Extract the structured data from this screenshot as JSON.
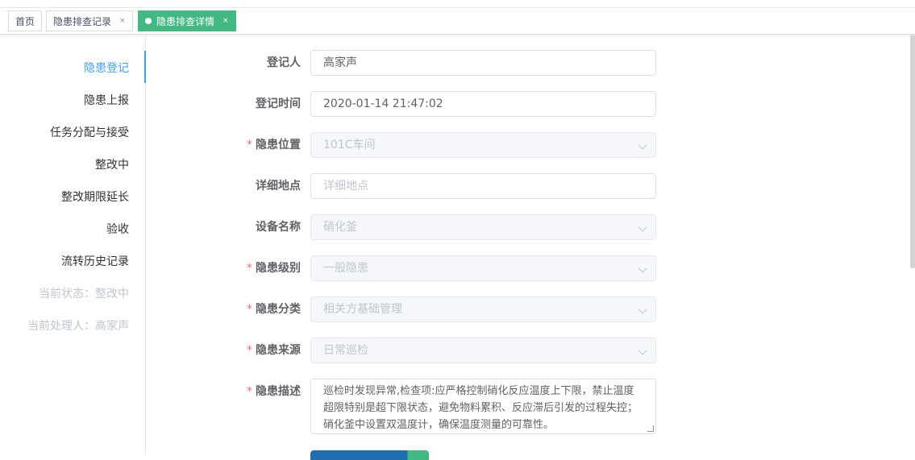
{
  "tabs": [
    {
      "label": "首页"
    },
    {
      "label": "隐患排查记录",
      "close": "×"
    },
    {
      "label": "隐患排查详情",
      "close": "×"
    }
  ],
  "sidebar": {
    "items": [
      {
        "label": "隐患登记"
      },
      {
        "label": "隐患上报"
      },
      {
        "label": "任务分配与接受"
      },
      {
        "label": "整改中"
      },
      {
        "label": "整改期限延长"
      },
      {
        "label": "验收"
      },
      {
        "label": "流转历史记录"
      }
    ],
    "status": "当前状态：整改中",
    "handler": "当前处理人：高家声"
  },
  "form": {
    "registrant": {
      "label": "登记人",
      "value": "高家声"
    },
    "reg_time": {
      "label": "登记时间",
      "value": "2020-01-14 21:47:02"
    },
    "location": {
      "label": "隐患位置",
      "value": "101C车间",
      "required": "*"
    },
    "detail_place": {
      "label": "详细地点",
      "placeholder": "详细地点"
    },
    "equipment": {
      "label": "设备名称",
      "value": "硝化釜"
    },
    "level": {
      "label": "隐患级别",
      "value": "一般隐患",
      "required": "*"
    },
    "category": {
      "label": "隐患分类",
      "value": "相关方基础管理",
      "required": "*"
    },
    "source": {
      "label": "隐患来源",
      "value": "日常巡检",
      "required": "*"
    },
    "description": {
      "label": "隐患描述",
      "required": "*",
      "value": "巡检时发现异常,检查项:应严格控制硝化反应温度上下限，禁止温度超限特别是超下限状态，避免物料累积、反应滞后引发的过程失控；硝化釜中设置双温度计，确保温度测量的可靠性。"
    }
  },
  "colors": {
    "accent": "#42b983",
    "active_nav": "#409eff",
    "required": "#f56c6c"
  }
}
